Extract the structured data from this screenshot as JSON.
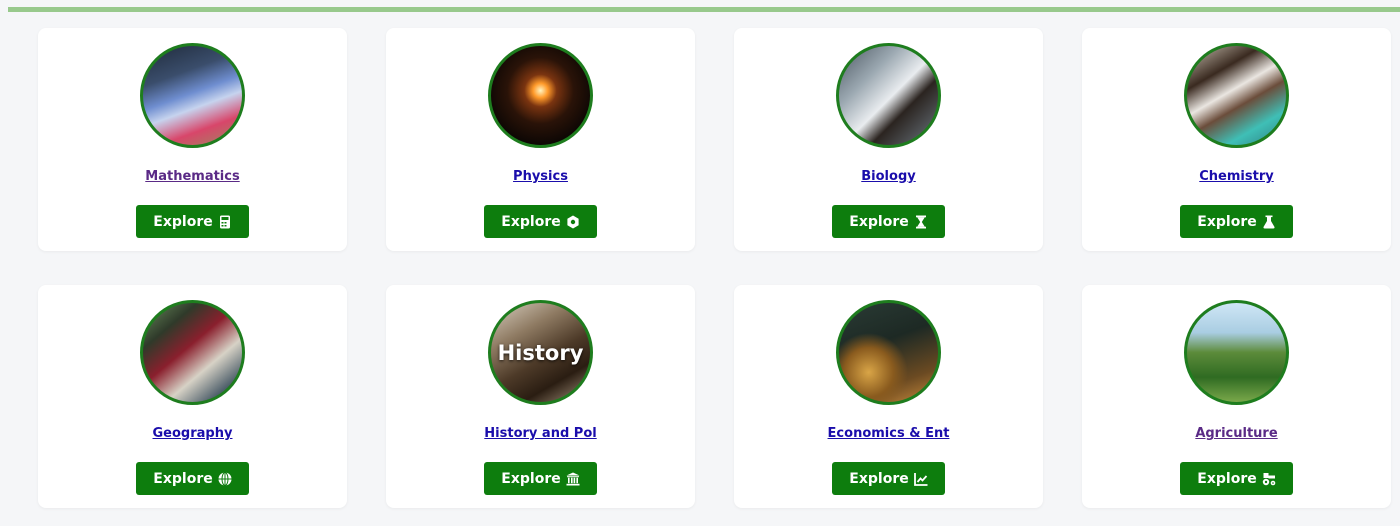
{
  "subjects": [
    {
      "name": "Mathematics",
      "button": "Explore",
      "icon": "calculator-icon",
      "visited": true,
      "image_text": ""
    },
    {
      "name": "Physics",
      "button": "Explore",
      "icon": "atom-icon",
      "visited": false,
      "image_text": ""
    },
    {
      "name": "Biology",
      "button": "Explore",
      "icon": "hourglass-icon",
      "visited": false,
      "image_text": ""
    },
    {
      "name": "Chemistry",
      "button": "Explore",
      "icon": "flask-icon",
      "visited": false,
      "image_text": ""
    },
    {
      "name": "Geography",
      "button": "Explore",
      "icon": "globe-icon",
      "visited": false,
      "image_text": ""
    },
    {
      "name": "History and Pol",
      "button": "Explore",
      "icon": "landmark-icon",
      "visited": false,
      "image_text": "History"
    },
    {
      "name": "Economics & Ent",
      "button": "Explore",
      "icon": "chart-line-icon",
      "visited": false,
      "image_text": ""
    },
    {
      "name": "Agriculture",
      "button": "Explore",
      "icon": "tractor-icon",
      "visited": true,
      "image_text": ""
    }
  ],
  "colors": {
    "accent_bar": "#98c98c",
    "button_bg": "#0d7d0d",
    "avatar_border": "#1e7d1e",
    "link": "#1a0dab",
    "link_visited": "#5a2a86"
  }
}
